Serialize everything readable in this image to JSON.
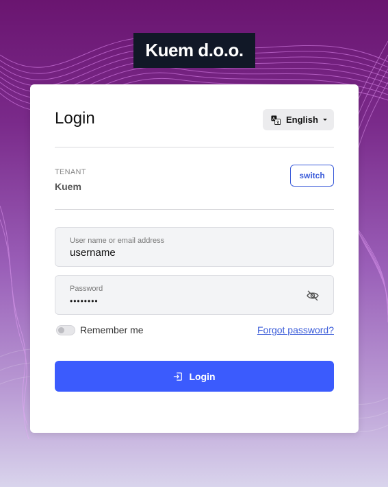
{
  "brand": {
    "name": "Kuem d.o.o."
  },
  "login_card": {
    "title": "Login",
    "language": {
      "selected": "English",
      "icon": "translate-icon"
    },
    "tenant": {
      "label": "TENANT",
      "value": "Kuem",
      "switch_label": "switch"
    },
    "username": {
      "label": "User name or email address",
      "value": "username"
    },
    "password": {
      "label": "Password",
      "value": "••••••••",
      "visibility_icon": "eye-slash-icon"
    },
    "remember": {
      "label": "Remember me",
      "checked": false
    },
    "forgot_link": "Forgot password?",
    "submit": {
      "label": "Login",
      "icon": "sign-in-icon"
    }
  },
  "colors": {
    "primary": "#3b5bfd",
    "link": "#3a5bd9",
    "logo_bg": "#111827"
  }
}
